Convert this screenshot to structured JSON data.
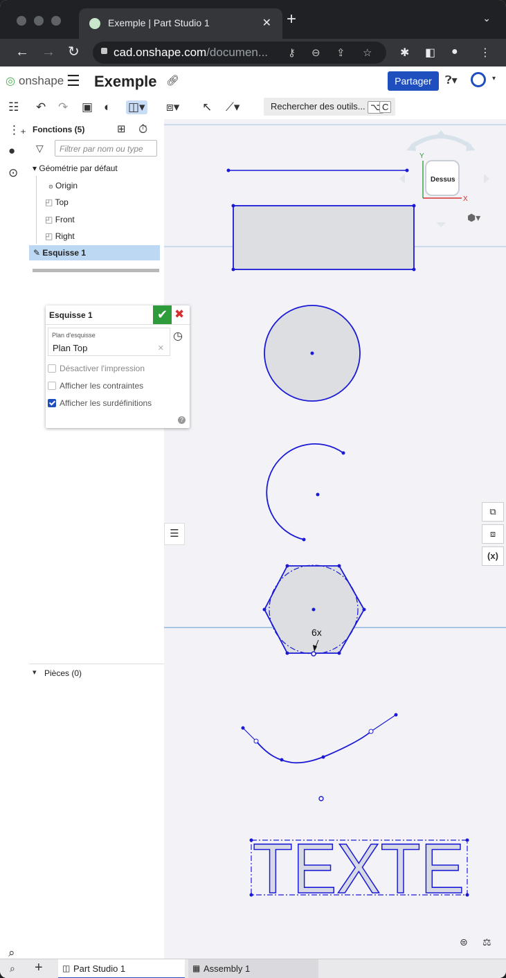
{
  "browser": {
    "tab_title": "Exemple | Part Studio 1",
    "tab_close": "✕",
    "new_tab": "+",
    "url_host": "cad.onshape.com",
    "url_path": "/documen..."
  },
  "header": {
    "brand": "onshape",
    "doc_title": "Exemple",
    "share_label": "Partager"
  },
  "toolbar": {
    "search_label": "Rechercher des outils...",
    "kbd1": "⌥",
    "kbd2": "C"
  },
  "features": {
    "title": "Fonctions (5)",
    "filter_placeholder": "Filtrer par nom ou type",
    "default_geometry": "Géométrie par défaut",
    "items": [
      "Origin",
      "Top",
      "Front",
      "Right"
    ],
    "sketch": "Esquisse 1",
    "parts": "Pièces (0)"
  },
  "sketch_dialog": {
    "title": "Esquisse 1",
    "plane_label": "Plan d'esquisse",
    "plane_value": "Plan Top",
    "options": [
      {
        "label": "Désactiver l'impression",
        "checked": false,
        "disabled": true
      },
      {
        "label": "Afficher les contraintes",
        "checked": false,
        "disabled": false
      },
      {
        "label": "Afficher les surdéfinitions",
        "checked": true,
        "disabled": false
      }
    ]
  },
  "viewcube": {
    "face": "Dessus",
    "axis_y": "Y",
    "axis_x": "X"
  },
  "canvas": {
    "dimension_label": "6x",
    "text_entity": "TEXTE"
  },
  "tabs": {
    "part_studio": "Part Studio 1",
    "assembly": "Assembly 1"
  },
  "colors": {
    "sketch_blue": "#1a1ad6",
    "share_blue": "#1f4fbe",
    "ok_green": "#2e9c3a",
    "selection": "#bcd8f2"
  }
}
